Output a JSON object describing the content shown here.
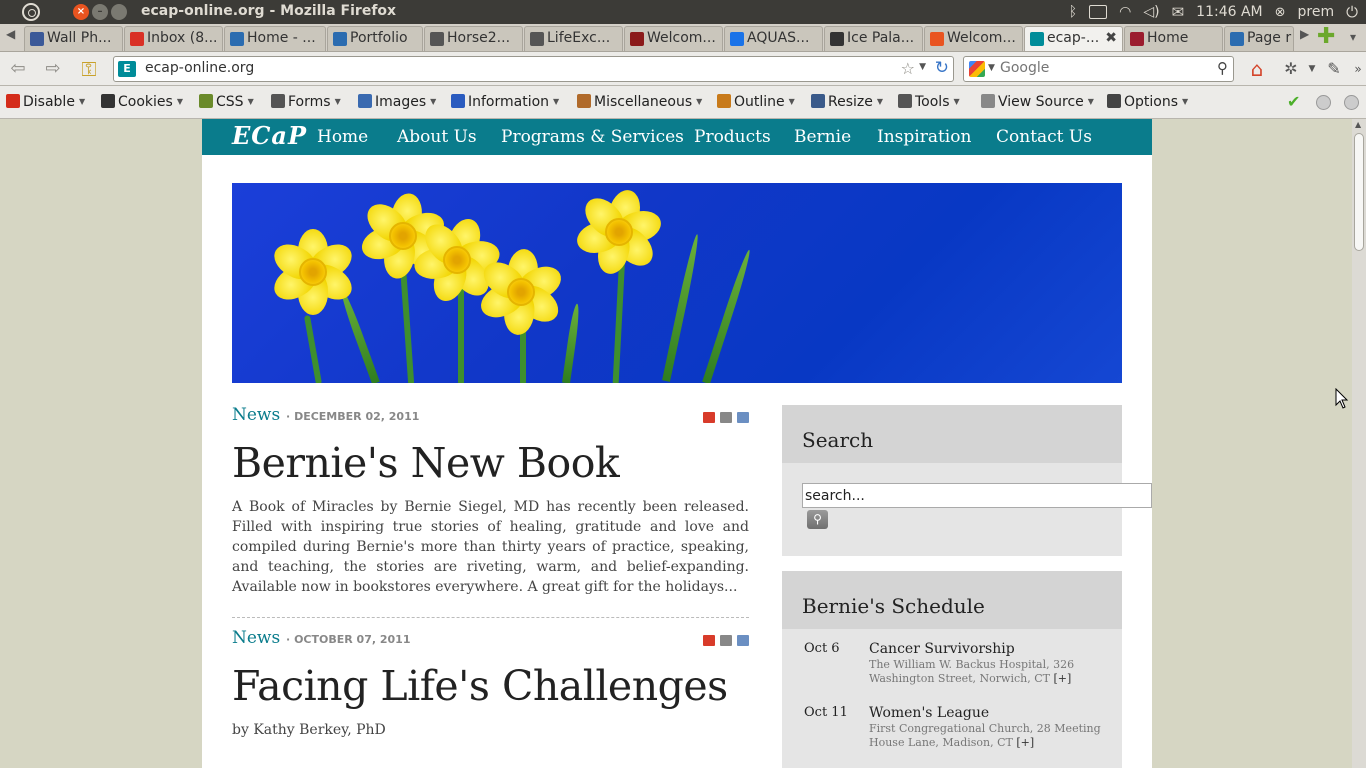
{
  "window": {
    "title": "ecap-online.org - Mozilla Firefox",
    "clock": "11:46 AM",
    "user": "prem"
  },
  "tabs": [
    {
      "label": "Wall Ph...",
      "color": "#3b5998"
    },
    {
      "label": "Inbox (8...",
      "color": "#d93025"
    },
    {
      "label": "Home - ...",
      "color": "#2b6cb0"
    },
    {
      "label": "Portfolio",
      "color": "#2b6cb0"
    },
    {
      "label": "Horse2...",
      "color": "#555555"
    },
    {
      "label": "LifeExc...",
      "color": "#555555"
    },
    {
      "label": "Welcom...",
      "color": "#8b1a1a"
    },
    {
      "label": "AQUAS...",
      "color": "#1a73e8"
    },
    {
      "label": "Ice Pala...",
      "color": "#333333"
    },
    {
      "label": "Welcom...",
      "color": "#e95420"
    },
    {
      "label": "ecap-...",
      "color": "#008c99"
    },
    {
      "label": "Home",
      "color": "#9b1c2e"
    },
    {
      "label": "Page r",
      "color": "#2b6cb0"
    }
  ],
  "urlbar": {
    "url": "ecap-online.org",
    "search_placeholder": "Google"
  },
  "devtoolbar": {
    "items": [
      {
        "label": "Disable",
        "icon": "disable-icon",
        "color": "#d42c1a"
      },
      {
        "label": "Cookies",
        "icon": "cookies-icon",
        "color": "#333333"
      },
      {
        "label": "CSS",
        "icon": "css-icon",
        "color": "#6a8a2a"
      },
      {
        "label": "Forms",
        "icon": "forms-icon",
        "color": "#555555"
      },
      {
        "label": "Images",
        "icon": "images-icon",
        "color": "#3a6ab0"
      },
      {
        "label": "Information",
        "icon": "information-icon",
        "color": "#2a5bbf"
      },
      {
        "label": "Miscellaneous",
        "icon": "miscellaneous-icon",
        "color": "#b06a2a"
      },
      {
        "label": "Outline",
        "icon": "outline-icon",
        "color": "#c87a1a"
      },
      {
        "label": "Resize",
        "icon": "resize-icon",
        "color": "#3a5a8a"
      },
      {
        "label": "Tools",
        "icon": "tools-icon",
        "color": "#555555"
      },
      {
        "label": "View Source",
        "icon": "view-source-icon",
        "color": "#888888"
      },
      {
        "label": "Options",
        "icon": "options-icon",
        "color": "#444444"
      }
    ]
  },
  "site": {
    "logo": "ECaP",
    "nav": [
      "Home",
      "About Us",
      "Programs & Services",
      "Products",
      "Bernie",
      "Inspiration",
      "Contact Us"
    ],
    "accent": "#0a7c8c"
  },
  "posts": [
    {
      "category": "News",
      "date": "DECEMBER 02, 2011",
      "title": "Bernie's New Book",
      "body": "A Book of Miracles by Bernie Siegel, MD has recently been released. Filled with inspiring true stories of healing, gratitude and love and compiled during Bernie's more than thirty years of practice, speaking, and teaching, the stories are riveting, warm, and belief-expanding. Available now in bookstores everywhere. A great gift for the holidays..."
    },
    {
      "category": "News",
      "date": "OCTOBER 07, 2011",
      "title": "Facing Life's Challenges",
      "body": "by Kathy Berkey, PhD"
    }
  ],
  "sidebar": {
    "search_title": "Search",
    "search_placeholder": "search...",
    "schedule_title": "Bernie's Schedule",
    "schedule": [
      {
        "date": "Oct 6",
        "title": "Cancer Survivorship",
        "desc": "The William W. Backus Hospital, 326 Washington Street, Norwich, CT",
        "more": "[+]"
      },
      {
        "date": "Oct 11",
        "title": "Women's League",
        "desc": "First Congregational Church, 28 Meeting House Lane, Madison, CT",
        "more": "[+]"
      }
    ]
  }
}
